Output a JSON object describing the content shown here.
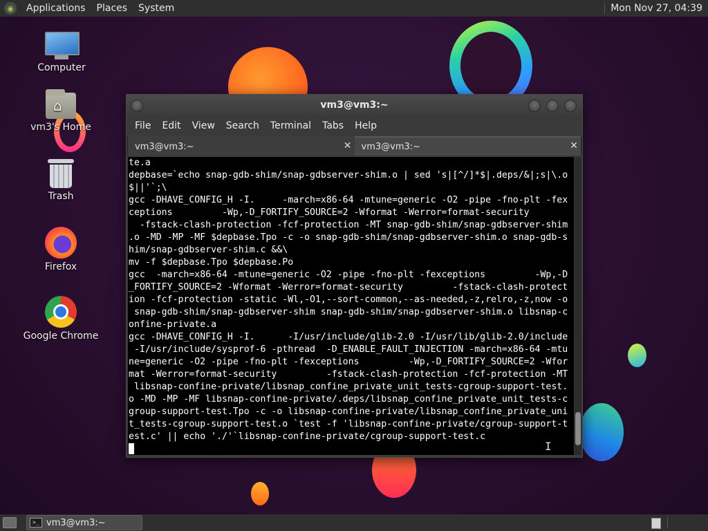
{
  "top_panel": {
    "menus": [
      "Applications",
      "Places",
      "System"
    ],
    "clock": "Mon Nov 27, 04:39"
  },
  "desktop": {
    "icons": [
      {
        "label": "Computer",
        "icon": "computer-icon"
      },
      {
        "label": "vm3's Home",
        "icon": "home-folder-icon"
      },
      {
        "label": "Trash",
        "icon": "trash-icon"
      },
      {
        "label": "Firefox",
        "icon": "firefox-icon"
      },
      {
        "label": "Google Chrome",
        "icon": "chrome-icon"
      }
    ]
  },
  "terminal": {
    "title": "vm3@vm3:~",
    "menus": [
      "File",
      "Edit",
      "View",
      "Search",
      "Terminal",
      "Tabs",
      "Help"
    ],
    "tabs": [
      {
        "label": "vm3@vm3:~",
        "state": "inactive"
      },
      {
        "label": "vm3@vm3:~",
        "state": "active"
      }
    ],
    "lines": [
      "te.a",
      "depbase=`echo snap-gdb-shim/snap-gdbserver-shim.o | sed 's|[^/]*$|.deps/&|;s|\\.o",
      "$||'`;\\",
      "gcc -DHAVE_CONFIG_H -I.     -march=x86-64 -mtune=generic -O2 -pipe -fno-plt -fex",
      "ceptions         -Wp,-D_FORTIFY_SOURCE=2 -Wformat -Werror=format-security",
      "  -fstack-clash-protection -fcf-protection -MT snap-gdb-shim/snap-gdbserver-shim",
      ".o -MD -MP -MF $depbase.Tpo -c -o snap-gdb-shim/snap-gdbserver-shim.o snap-gdb-s",
      "him/snap-gdbserver-shim.c &&\\",
      "mv -f $depbase.Tpo $depbase.Po",
      "gcc  -march=x86-64 -mtune=generic -O2 -pipe -fno-plt -fexceptions         -Wp,-D",
      "_FORTIFY_SOURCE=2 -Wformat -Werror=format-security         -fstack-clash-protect",
      "ion -fcf-protection -static -Wl,-O1,--sort-common,--as-needed,-z,relro,-z,now -o",
      " snap-gdb-shim/snap-gdbserver-shim snap-gdb-shim/snap-gdbserver-shim.o libsnap-c",
      "onfine-private.a",
      "gcc -DHAVE_CONFIG_H -I.      -I/usr/include/glib-2.0 -I/usr/lib/glib-2.0/include",
      " -I/usr/include/sysprof-6 -pthread  -D_ENABLE_FAULT_INJECTION -march=x86-64 -mtu",
      "ne=generic -O2 -pipe -fno-plt -fexceptions         -Wp,-D_FORTIFY_SOURCE=2 -Wfor",
      "mat -Werror=format-security         -fstack-clash-protection -fcf-protection -MT",
      " libsnap-confine-private/libsnap_confine_private_unit_tests-cgroup-support-test.",
      "o -MD -MP -MF libsnap-confine-private/.deps/libsnap_confine_private_unit_tests-c",
      "group-support-test.Tpo -c -o libsnap-confine-private/libsnap_confine_private_uni",
      "t_tests-cgroup-support-test.o `test -f 'libsnap-confine-private/cgroup-support-t",
      "est.c' || echo './'`libsnap-confine-private/cgroup-support-test.c"
    ]
  },
  "bottom_panel": {
    "task_label": "vm3@vm3:~"
  }
}
